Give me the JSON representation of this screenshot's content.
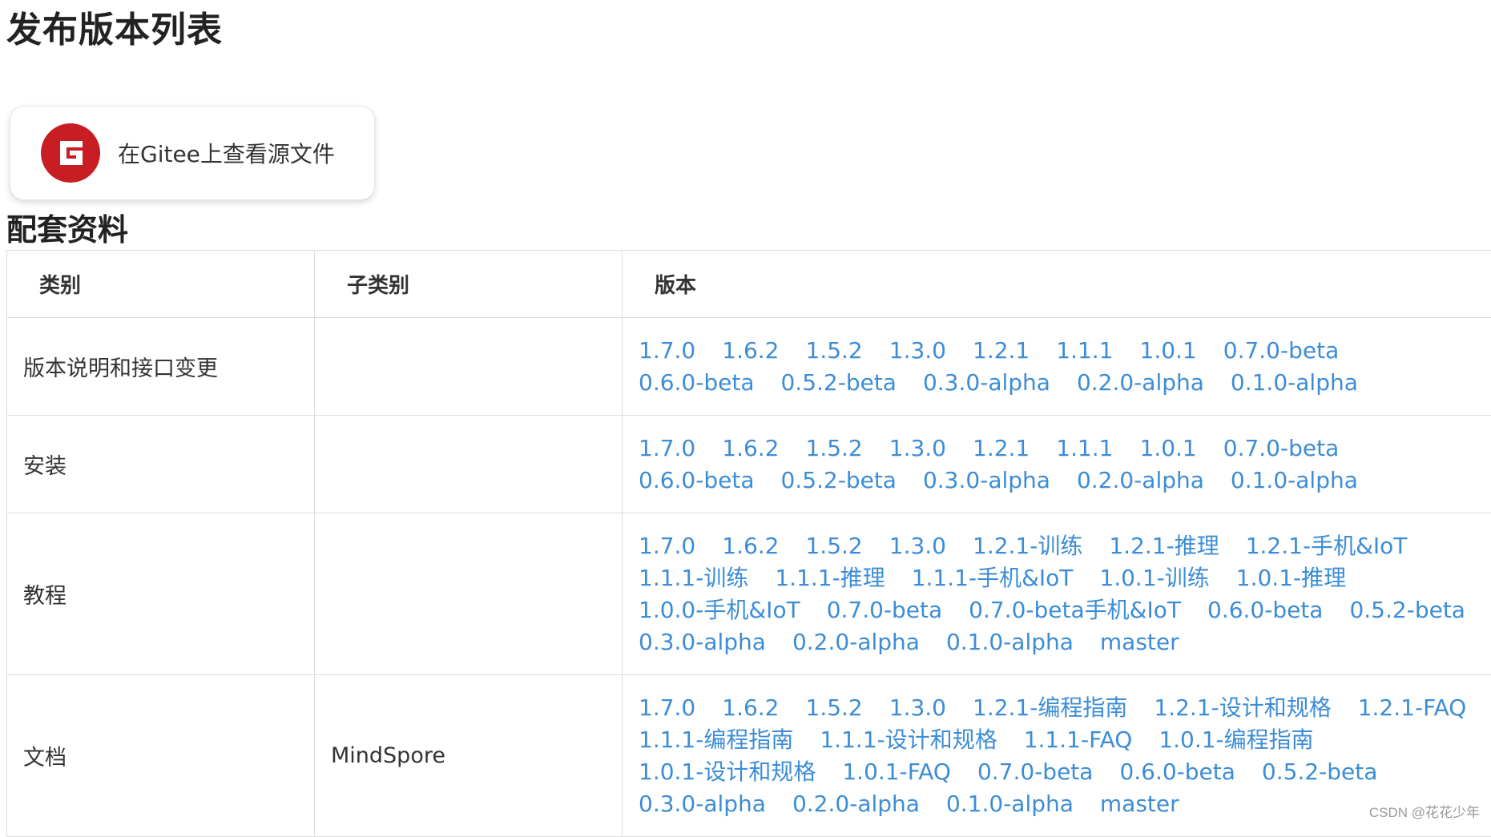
{
  "page_title": "发布版本列表",
  "gitee": {
    "button_label": "在Gitee上查看源文件",
    "logo_color": "#c71d23",
    "logo_icon": "gitee-logo-icon"
  },
  "section_title": "配套资料",
  "table": {
    "headers": [
      "类别",
      "子类别",
      "版本"
    ],
    "rows": [
      {
        "category": "版本说明和接口变更",
        "subcategory": "",
        "versions": [
          "1.7.0",
          "1.6.2",
          "1.5.2",
          "1.3.0",
          "1.2.1",
          "1.1.1",
          "1.0.1",
          "0.7.0-beta",
          "0.6.0-beta",
          "0.5.2-beta",
          "0.3.0-alpha",
          "0.2.0-alpha",
          "0.1.0-alpha"
        ]
      },
      {
        "category": "安装",
        "subcategory": "",
        "versions": [
          "1.7.0",
          "1.6.2",
          "1.5.2",
          "1.3.0",
          "1.2.1",
          "1.1.1",
          "1.0.1",
          "0.7.0-beta",
          "0.6.0-beta",
          "0.5.2-beta",
          "0.3.0-alpha",
          "0.2.0-alpha",
          "0.1.0-alpha"
        ]
      },
      {
        "category": "教程",
        "subcategory": "",
        "versions": [
          "1.7.0",
          "1.6.2",
          "1.5.2",
          "1.3.0",
          "1.2.1-训练",
          "1.2.1-推理",
          "1.2.1-手机&IoT",
          "1.1.1-训练",
          "1.1.1-推理",
          "1.1.1-手机&IoT",
          "1.0.1-训练",
          "1.0.1-推理",
          "1.0.0-手机&IoT",
          "0.7.0-beta",
          "0.7.0-beta手机&IoT",
          "0.6.0-beta",
          "0.5.2-beta",
          "0.3.0-alpha",
          "0.2.0-alpha",
          "0.1.0-alpha",
          "master"
        ]
      },
      {
        "category": "文档",
        "subcategory": "MindSpore",
        "versions": [
          "1.7.0",
          "1.6.2",
          "1.5.2",
          "1.3.0",
          "1.2.1-编程指南",
          "1.2.1-设计和规格",
          "1.2.1-FAQ",
          "1.1.1-编程指南",
          "1.1.1-设计和规格",
          "1.1.1-FAQ",
          "1.0.1-编程指南",
          "1.0.1-设计和规格",
          "1.0.1-FAQ",
          "0.7.0-beta",
          "0.6.0-beta",
          "0.5.2-beta",
          "0.3.0-alpha",
          "0.2.0-alpha",
          "0.1.0-alpha",
          "master"
        ]
      }
    ]
  },
  "link_color": "#3c8dd6",
  "watermark": "CSDN @花花少年"
}
